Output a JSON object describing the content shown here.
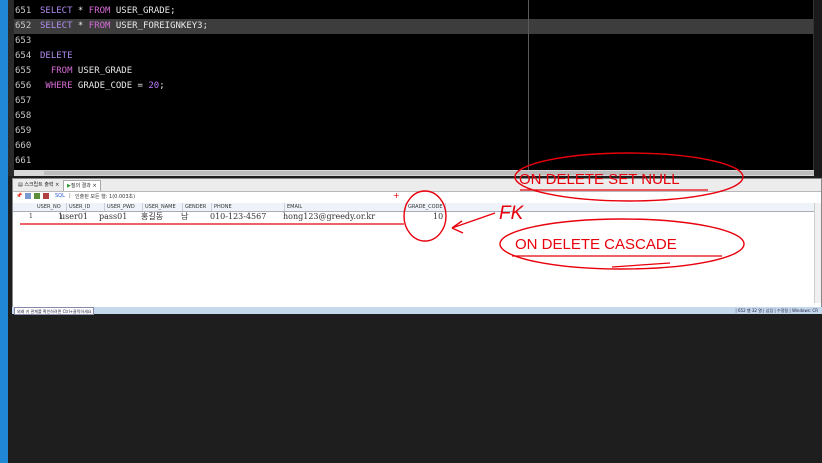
{
  "editor": {
    "lines": [
      {
        "no": "651",
        "segments": [
          {
            "t": "SELECT",
            "c": "kw"
          },
          {
            "t": " * ",
            "c": ""
          },
          {
            "t": "FROM",
            "c": "kw2"
          },
          {
            "t": " USER_GRADE;",
            "c": ""
          }
        ],
        "highlight": false
      },
      {
        "no": "652",
        "segments": [
          {
            "t": "SELECT",
            "c": "kw"
          },
          {
            "t": " * ",
            "c": ""
          },
          {
            "t": "FROM",
            "c": "kw2"
          },
          {
            "t": " USER_FOREIGNKEY3;",
            "c": ""
          }
        ],
        "highlight": true
      },
      {
        "no": "653",
        "segments": [],
        "highlight": false
      },
      {
        "no": "654",
        "segments": [
          {
            "t": "DELETE",
            "c": "kw"
          }
        ],
        "highlight": false
      },
      {
        "no": "655",
        "segments": [
          {
            "t": "  FROM",
            "c": "kw2"
          },
          {
            "t": " USER_GRADE",
            "c": ""
          }
        ],
        "highlight": false
      },
      {
        "no": "656",
        "segments": [
          {
            "t": " WHERE",
            "c": "kw2"
          },
          {
            "t": " GRADE_CODE = ",
            "c": ""
          },
          {
            "t": "20",
            "c": "num"
          },
          {
            "t": ";",
            "c": ""
          }
        ],
        "highlight": false
      },
      {
        "no": "657",
        "segments": [],
        "highlight": false
      },
      {
        "no": "658",
        "segments": [],
        "highlight": false
      },
      {
        "no": "659",
        "segments": [],
        "highlight": false
      },
      {
        "no": "660",
        "segments": [],
        "highlight": false
      },
      {
        "no": "661",
        "segments": [],
        "highlight": false
      }
    ]
  },
  "panel": {
    "tab_script": "스크립트 출력",
    "tab_query": "질의 결과",
    "toolbar_sql": "SQL",
    "toolbar_status": "인출된 모든 행: 1(0.003초)",
    "columns": [
      "USER_NO",
      "USER_ID",
      "USER_PWD",
      "USER_NAME",
      "GENDER",
      "PHONE",
      "EMAIL",
      "GRADE_CODE"
    ],
    "rows": [
      {
        "rownum": "1",
        "cells": [
          "1",
          "user01",
          "pass01",
          "홍길동",
          "남",
          "010-123-4567",
          "hong123@greedy.or.kr",
          "10"
        ]
      }
    ]
  },
  "status": {
    "left": "외래 키 관계를 확인하려면 Ctrl+클릭하세요",
    "right": "| 652 행 32 열 | 삽입 | 수정됨 | Windows: CR"
  },
  "annotations": {
    "set_null": "ON DELETE SET NULL",
    "fk": "FK",
    "cascade": "ON DELETE CASCADE"
  },
  "colors": {
    "accent_blue": "#1f87d6",
    "annotation_red": "#e8000c",
    "keyword": "#b08cf0",
    "keyword2": "#d76bd6"
  }
}
